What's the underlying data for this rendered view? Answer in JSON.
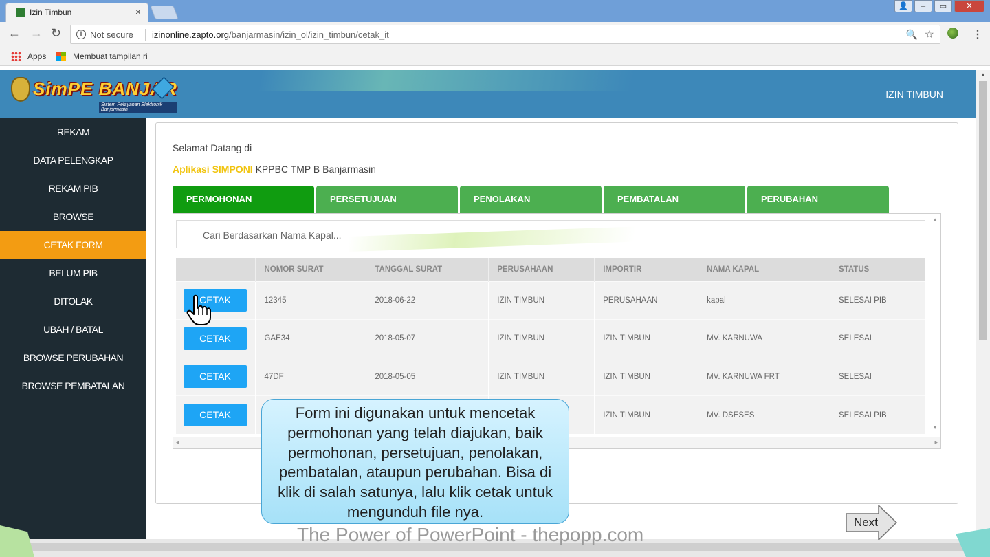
{
  "browser": {
    "tab_title": "Izin Timbun",
    "tab_close": "×",
    "security_label": "Not secure",
    "url_host": "izinonline.zapto.org",
    "url_path": "/banjarmasin/izin_ol/izin_timbun/cetak_it",
    "bookmarks": [
      {
        "label": "Apps"
      },
      {
        "label": "Membuat tampilan ri"
      }
    ],
    "back": "←",
    "forward": "→",
    "reload": "↻",
    "menu": "⋮",
    "star": "☆",
    "zoom": "🔍"
  },
  "header": {
    "logo_text": "SimPE BANJAR",
    "logo_sub": "Sistem Pelayanan Elektronik Banjarmasin",
    "title": "IZIN TIMBUN"
  },
  "sidebar": {
    "items": [
      {
        "label": "REKAM"
      },
      {
        "label": "DATA PELENGKAP"
      },
      {
        "label": "REKAM PIB"
      },
      {
        "label": "BROWSE"
      },
      {
        "label": "CETAK FORM"
      },
      {
        "label": "BELUM PIB"
      },
      {
        "label": "DITOLAK"
      },
      {
        "label": "UBAH / BATAL"
      },
      {
        "label": "BROWSE PERUBAHAN"
      },
      {
        "label": "BROWSE PEMBATALAN"
      }
    ],
    "active_index": 4
  },
  "main": {
    "welcome": "Selamat Datang di",
    "app_highlight": "Aplikasi SIMPONI",
    "app_rest": " KPPBC TMP B Banjarmasin",
    "tabs": [
      {
        "label": "PERMOHONAN"
      },
      {
        "label": "PERSETUJUAN"
      },
      {
        "label": "PENOLAKAN"
      },
      {
        "label": "PEMBATALAN"
      },
      {
        "label": "PERUBAHAN"
      }
    ],
    "search_placeholder": "Cari Berdasarkan Nama Kapal...",
    "table": {
      "headers": [
        "",
        "NOMOR SURAT",
        "TANGGAL SURAT",
        "PERUSAHAAN",
        "IMPORTIR",
        "NAMA KAPAL",
        "STATUS"
      ],
      "button_label": "CETAK",
      "rows": [
        {
          "nomor": "12345",
          "tanggal": "2018-06-22",
          "perusahaan": "IZIN TIMBUN",
          "importir": "PERUSAHAAN",
          "kapal": "kapal",
          "status": "SELESAI PIB"
        },
        {
          "nomor": "GAE34",
          "tanggal": "2018-05-07",
          "perusahaan": "IZIN TIMBUN",
          "importir": "IZIN TIMBUN",
          "kapal": "MV. KARNUWA",
          "status": "SELESAI"
        },
        {
          "nomor": "47DF",
          "tanggal": "2018-05-05",
          "perusahaan": "IZIN TIMBUN",
          "importir": "IZIN TIMBUN",
          "kapal": "MV. KARNUWA FRT",
          "status": "SELESAI"
        },
        {
          "nomor": "",
          "tanggal": "",
          "perusahaan": "",
          "importir": "IZIN TIMBUN",
          "kapal": "MV. DSESES",
          "status": "SELESAI PIB"
        }
      ]
    }
  },
  "overlay": {
    "callout": "Form ini digunakan untuk mencetak permohonan yang telah diajukan, baik permohonan, persetujuan, penolakan, pembatalan, ataupun perubahan. Bisa di klik di salah satunya, lalu klik cetak untuk mengunduh file nya.",
    "next_label": "Next",
    "footer_credit": "The Power of PowerPoint - thepopp.com"
  },
  "colors": {
    "header_bg": "#3d88b9",
    "sidebar_bg": "#1e2b33",
    "sidebar_active": "#f39c12",
    "tab_active": "#109c10",
    "tab_inactive": "#4caf50",
    "button": "#1ea5f5",
    "highlight_text": "#f1c40f"
  }
}
